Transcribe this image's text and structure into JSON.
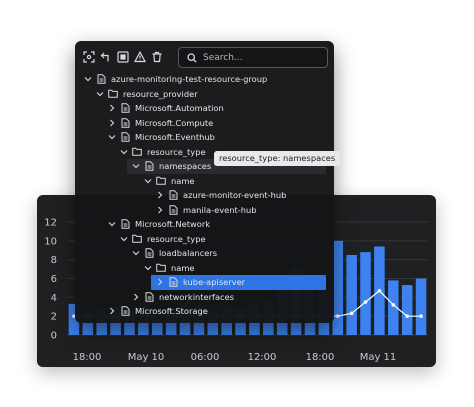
{
  "toolbar": {
    "icons": [
      "focus-icon",
      "undo-arrow-icon",
      "target-icon",
      "warning-icon",
      "trash-icon"
    ],
    "search_placeholder": "Search..."
  },
  "tree": [
    {
      "label": "azure-monitoring-test-resource-group",
      "depth": 0,
      "icon": "file",
      "expanded": true
    },
    {
      "label": "resource_provider",
      "depth": 1,
      "icon": "folder",
      "expanded": true
    },
    {
      "label": "Microsoft.Automation",
      "depth": 2,
      "icon": "file",
      "expanded": false
    },
    {
      "label": "Microsoft.Compute",
      "depth": 2,
      "icon": "file",
      "expanded": false
    },
    {
      "label": "Microsoft.Eventhub",
      "depth": 2,
      "icon": "file",
      "expanded": true
    },
    {
      "label": "resource_type",
      "depth": 3,
      "icon": "folder",
      "expanded": true
    },
    {
      "label": "namespaces",
      "depth": 4,
      "icon": "file",
      "expanded": true,
      "hover": true
    },
    {
      "label": "name",
      "depth": 5,
      "icon": "folder",
      "expanded": true
    },
    {
      "label": "azure-monitor-event-hub",
      "depth": 6,
      "icon": "file",
      "expanded": false
    },
    {
      "label": "manila-event-hub",
      "depth": 6,
      "icon": "file",
      "expanded": false
    },
    {
      "label": "Microsoft.Network",
      "depth": 2,
      "icon": "file",
      "expanded": true
    },
    {
      "label": "resource_type",
      "depth": 3,
      "icon": "folder",
      "expanded": true
    },
    {
      "label": "loadbalancers",
      "depth": 4,
      "icon": "file",
      "expanded": true
    },
    {
      "label": "name",
      "depth": 5,
      "icon": "folder",
      "expanded": true
    },
    {
      "label": "kube-apiserver",
      "depth": 6,
      "icon": "file",
      "expanded": false,
      "selected": true
    },
    {
      "label": "networkinterfaces",
      "depth": 4,
      "icon": "file",
      "expanded": false
    },
    {
      "label": "Microsoft.Storage",
      "depth": 2,
      "icon": "file",
      "expanded": false
    }
  ],
  "tooltip": "resource_type: namespaces",
  "colors": {
    "accent": "#2f74e4",
    "bar": "#3d82ef",
    "panel": "#141517",
    "card": "#1f2022"
  },
  "chart_data": {
    "type": "bar",
    "y_ticks": [
      "0",
      "2",
      "4",
      "6",
      "8",
      "10",
      "12"
    ],
    "ylim": [
      0,
      12
    ],
    "x_ticks": [
      "18:00",
      "May 10",
      "06:00",
      "12:00",
      "18:00",
      "May 11"
    ],
    "values": [
      3.3,
      2.6,
      2.8,
      3.0,
      2.5,
      3.1,
      2.7,
      2.9,
      3.4,
      3.2,
      2.6,
      3.0,
      2.8,
      3.3,
      3.5,
      5.0,
      7.2,
      6.4,
      4.8,
      10.0,
      8.5,
      8.8,
      9.4,
      5.8,
      5.3,
      6.0
    ],
    "line_points": [
      {
        "x": 0,
        "y": 2.0
      },
      {
        "x": 19,
        "y": 2.0
      },
      {
        "x": 20,
        "y": 2.3
      },
      {
        "x": 21,
        "y": 3.5
      },
      {
        "x": 22,
        "y": 4.7
      },
      {
        "x": 23,
        "y": 3.2
      },
      {
        "x": 24,
        "y": 2.0
      },
      {
        "x": 25,
        "y": 2.0
      }
    ],
    "grid": true
  }
}
